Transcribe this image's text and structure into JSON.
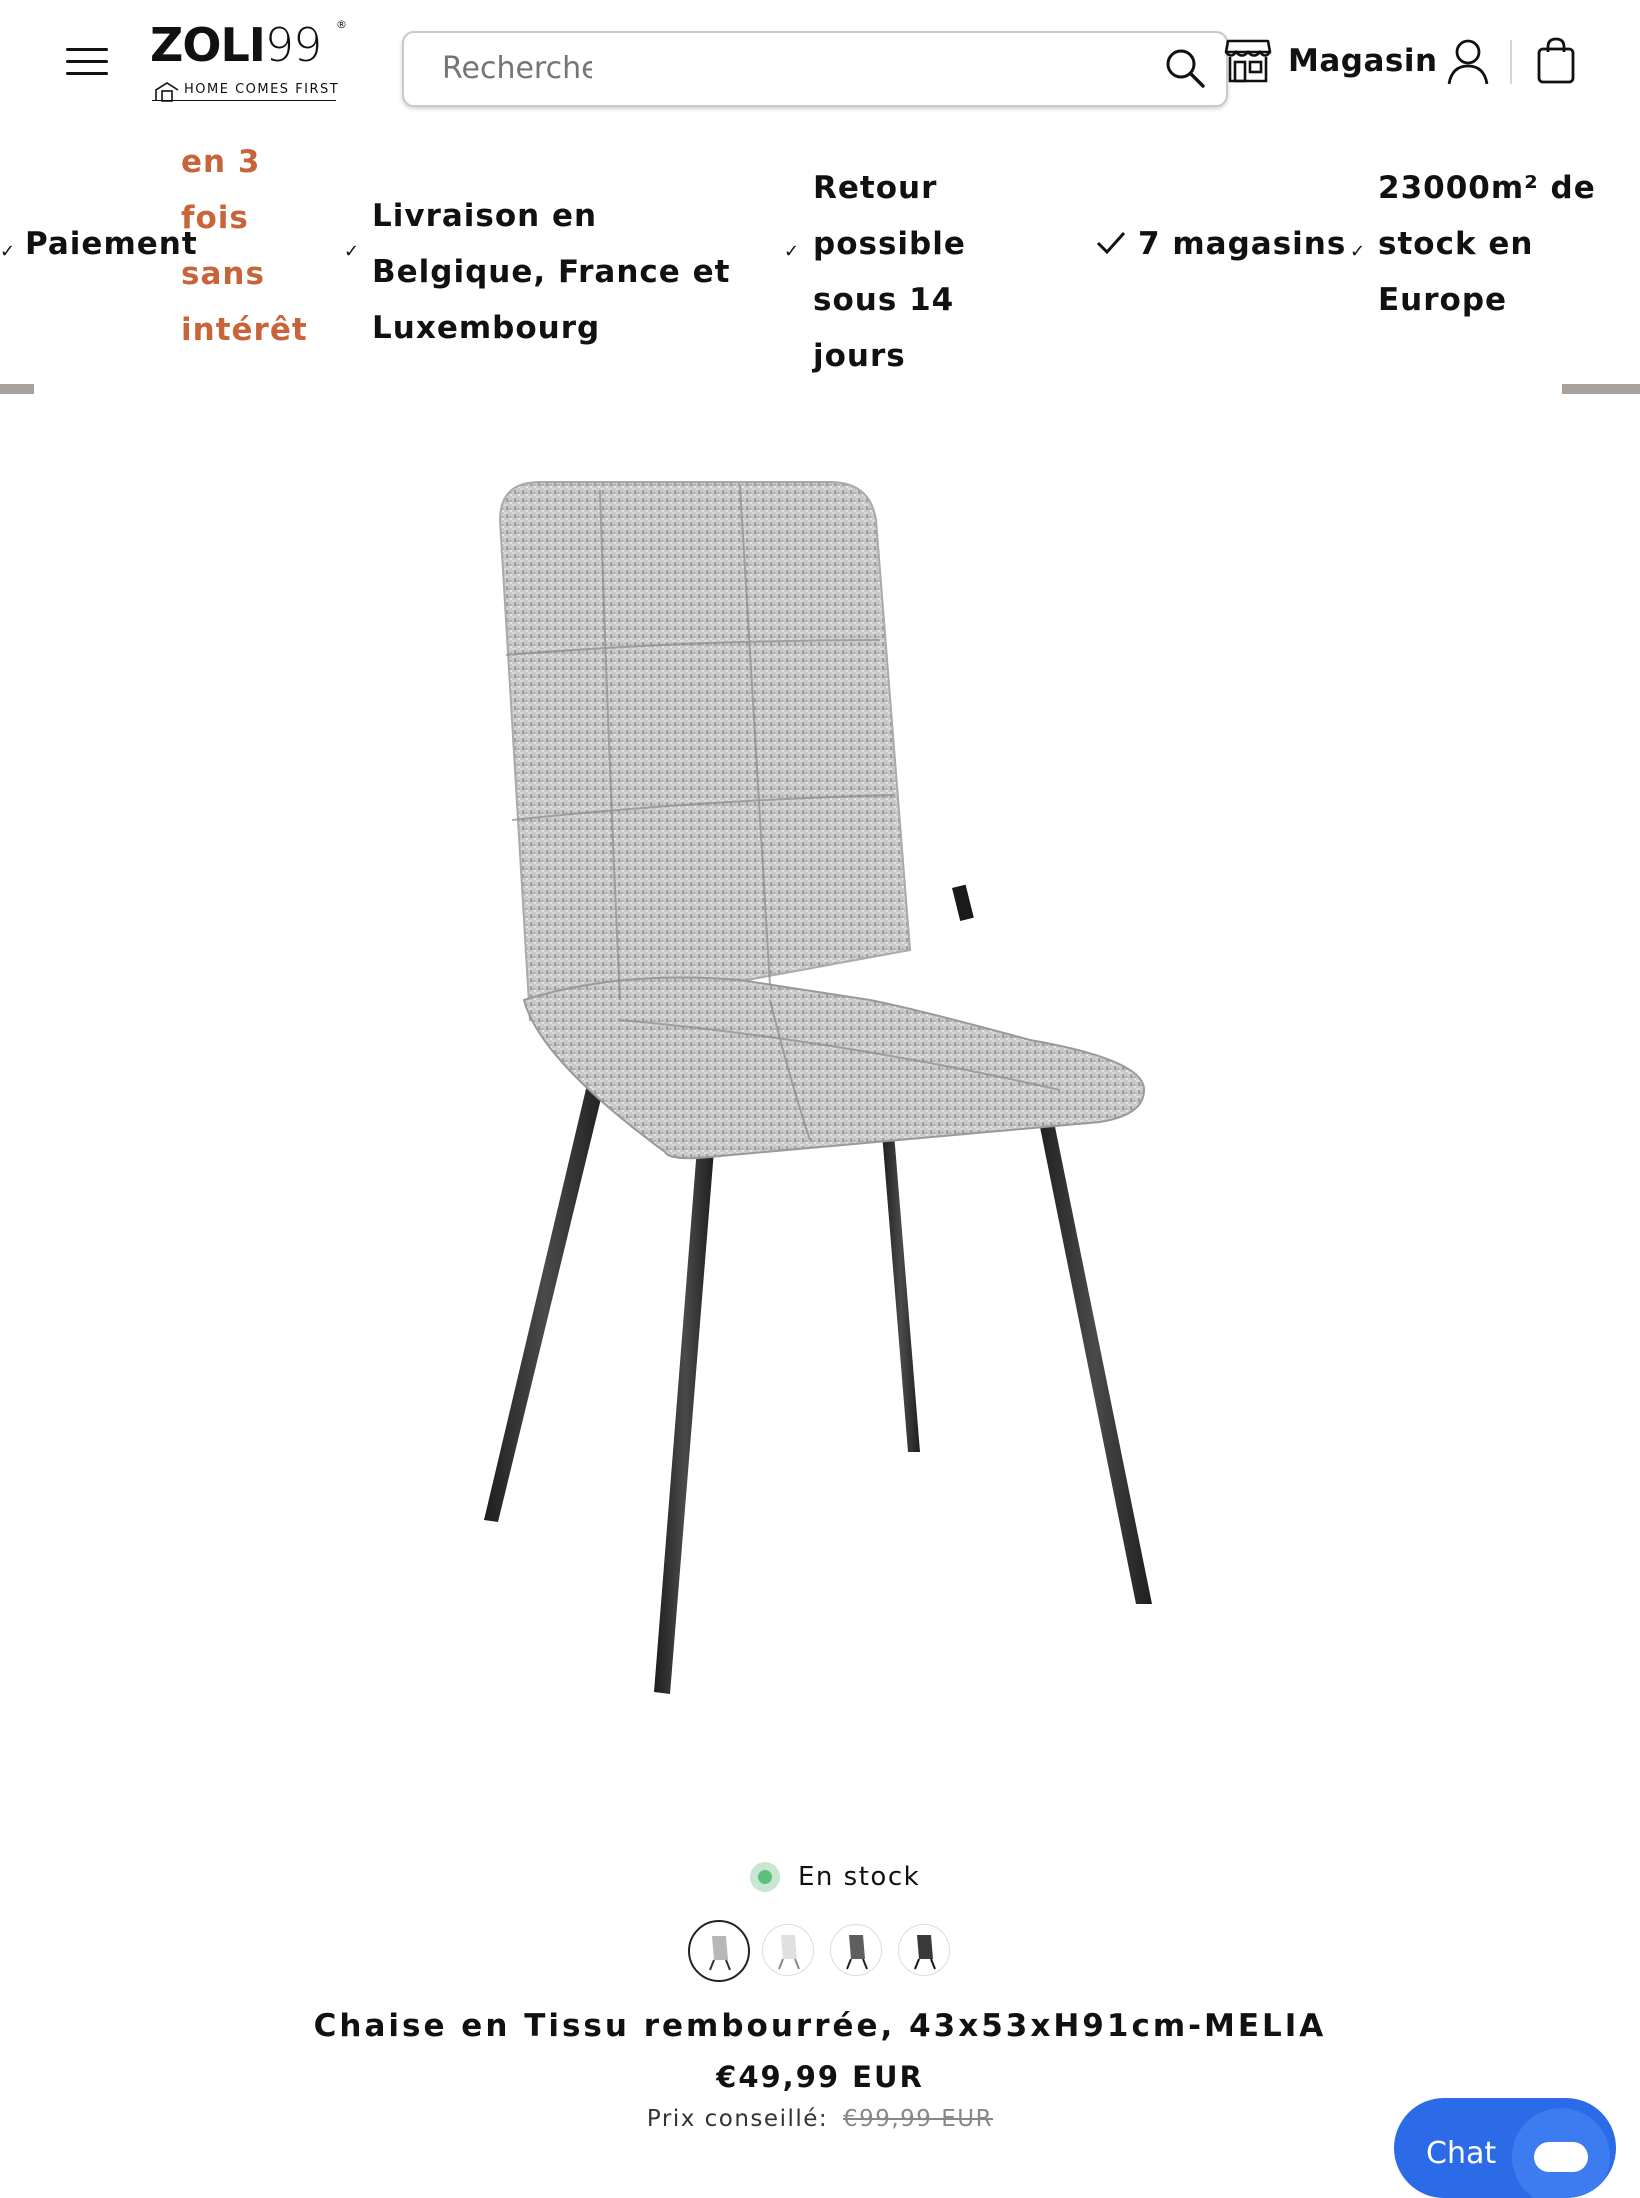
{
  "header": {
    "logo": {
      "word": "ZOLI99",
      "tagline": "HOME COMES FIRST"
    },
    "search": {
      "placeholder": "Recherche"
    },
    "store_label": "Magasin"
  },
  "usp_bar": {
    "items": [
      {
        "label": "Paiement",
        "highlight": "en 3 fois sans intérêt"
      },
      {
        "label": "Livraison en Belgique, France et Luxembourg"
      },
      {
        "label": "Retour possible sous 14 jours"
      },
      {
        "label": "7 magasins"
      },
      {
        "label": "23000m² de stock en Europe"
      }
    ],
    "highlight_color": "#c8643a"
  },
  "product": {
    "stock_status": "En stock",
    "stock_color": "#5cbf7b",
    "variants": [
      "light-grey",
      "white",
      "dark-grey",
      "charcoal"
    ],
    "selected_variant": 0,
    "title": "Chaise en Tissu rembourrée, 43x53xH91cm-MELIA",
    "price": "€49,99 EUR",
    "msrp_label": "Prix conseillé:",
    "msrp_value": "€99,99 EUR"
  },
  "chat": {
    "label": "Chat",
    "color": "#2b6be8"
  },
  "icons": [
    "menu-icon",
    "search-icon",
    "store-icon",
    "account-icon",
    "cart-icon",
    "check-icon",
    "chat-icon"
  ]
}
